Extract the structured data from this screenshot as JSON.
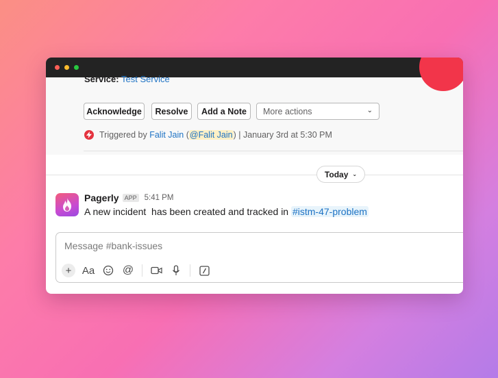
{
  "service": {
    "label": "Service:",
    "value": "Test Service"
  },
  "actions": {
    "acknowledge": "Acknowledge",
    "resolve": "Resolve",
    "add_note": "Add a Note",
    "more_actions": "More actions"
  },
  "trigger": {
    "prefix": "Triggered by",
    "user": "Falit Jain",
    "open_paren": "(",
    "mention": "@Falit Jain",
    "close_paren": ")",
    "suffix": "| January 3rd at 5:30 PM"
  },
  "divider": {
    "label": "Today"
  },
  "message": {
    "sender": "Pagerly",
    "badge": "APP",
    "time": "5:41 PM",
    "text": "A new incident  has been created and tracked in ",
    "channel": "#istm-47-problem"
  },
  "composer": {
    "placeholder": "Message #bank-issues"
  },
  "icons": [
    "plus-icon",
    "format-text-icon",
    "emoji-icon",
    "mention-icon",
    "video-icon",
    "microphone-icon",
    "slash-command-icon"
  ],
  "colors": {
    "link": "#1d72c4",
    "trigger_red": "#e4333f",
    "mention_bg": "#fdf0c6"
  }
}
